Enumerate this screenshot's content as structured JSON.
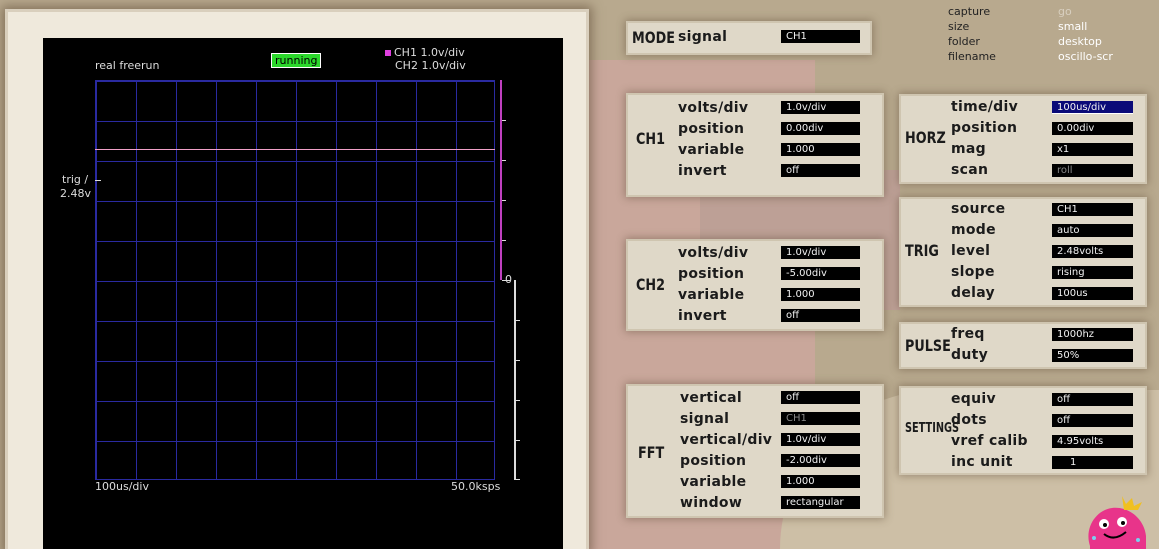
{
  "capture": {
    "labels": [
      "capture",
      "size",
      "folder",
      "filename"
    ],
    "values": [
      "go",
      "small",
      "desktop",
      "oscillo-scr"
    ]
  },
  "mode": {
    "label": "MODE",
    "field": "signal",
    "value": "CH1"
  },
  "scope": {
    "status_left": "real  freerun",
    "running": "running",
    "legend_ch1": "CH1 1.0v/div",
    "legend_ch2": "CH2 1.0v/div",
    "trig_label": "trig /",
    "trig_value": "2.48v",
    "zero_label": "0",
    "timebase": "100us/div",
    "samplerate": "50.0ksps"
  },
  "ch1": {
    "title": "CH1",
    "rows": [
      {
        "label": "volts/div",
        "value": "1.0v/div"
      },
      {
        "label": "position",
        "value": "0.00div"
      },
      {
        "label": "variable",
        "value": "1.000"
      },
      {
        "label": "invert",
        "value": "off"
      }
    ]
  },
  "ch2": {
    "title": "CH2",
    "rows": [
      {
        "label": "volts/div",
        "value": "1.0v/div"
      },
      {
        "label": "position",
        "value": "-5.00div"
      },
      {
        "label": "variable",
        "value": "1.000"
      },
      {
        "label": "invert",
        "value": "off"
      }
    ]
  },
  "fft": {
    "title": "FFT",
    "rows": [
      {
        "label": "vertical",
        "value": "off"
      },
      {
        "label": "signal",
        "value": "CH1"
      },
      {
        "label": "vertical/div",
        "value": "1.0v/div"
      },
      {
        "label": "position",
        "value": "-2.00div"
      },
      {
        "label": "variable",
        "value": "1.000"
      },
      {
        "label": "window",
        "value": "rectangular"
      }
    ]
  },
  "horz": {
    "title": "HORZ",
    "rows": [
      {
        "label": "time/div",
        "value": "100us/div"
      },
      {
        "label": "position",
        "value": "0.00div"
      },
      {
        "label": "mag",
        "value": "x1"
      },
      {
        "label": "scan",
        "value": "roll"
      }
    ]
  },
  "trig": {
    "title": "TRIG",
    "rows": [
      {
        "label": "source",
        "value": "CH1"
      },
      {
        "label": "mode",
        "value": "auto"
      },
      {
        "label": "level",
        "value": "2.48volts"
      },
      {
        "label": "slope",
        "value": "rising"
      },
      {
        "label": "delay",
        "value": "100us"
      }
    ]
  },
  "pulse": {
    "title": "PULSE",
    "rows": [
      {
        "label": "freq",
        "value": "1000hz"
      },
      {
        "label": "duty",
        "value": "50%"
      }
    ]
  },
  "settings": {
    "title": "SETTINGS",
    "rows": [
      {
        "label": "equiv",
        "value": "off"
      },
      {
        "label": "dots",
        "value": "off"
      },
      {
        "label": "vref calib",
        "value": "4.95volts"
      },
      {
        "label": "inc unit",
        "value": "1"
      }
    ]
  },
  "colors": {
    "ch1_trace": "#f0a0c8",
    "grid": "#2a2aa0",
    "running_bg": "#2bd82b",
    "selected_field": "#0a0a78"
  }
}
